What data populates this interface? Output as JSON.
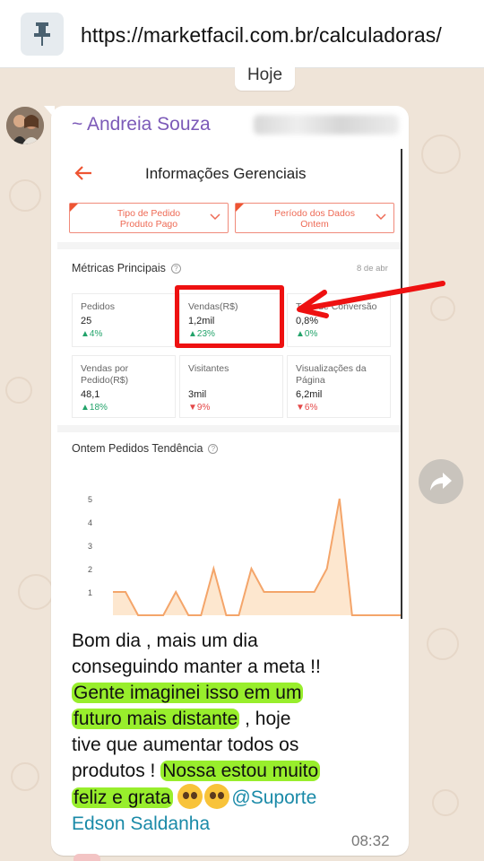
{
  "browser": {
    "url": "https://marketfacil.com.br/calculadoras/",
    "pin_icon": "pin-icon"
  },
  "chat": {
    "date_chip": "Hoje",
    "sender_name": "~ Andreia Souza",
    "time": "08:32",
    "message": {
      "line1": "Bom dia , mais um dia",
      "line2": "conseguindo manter a meta !!",
      "hl1a": "Gente imaginei isso em um",
      "hl1b": "futuro mais distante",
      "after_hl1": " , hoje",
      "line5": "tive que aumentar todos os",
      "line6_start": "produtos ! ",
      "hl2a": "Nossa estou muito",
      "hl2b": "feliz e grata",
      "mention_a": "@Suporte",
      "mention_b": "Edson Saldanha"
    }
  },
  "screenshot": {
    "title": "Informações Gerenciais",
    "filter1_line1": "Tipo de Pedido",
    "filter1_line2": "Produto Pago",
    "filter2_line1": "Período dos Dados",
    "filter2_line2": "Ontem",
    "metrics_title": "Métricas Principais",
    "metrics_date": "8 de abr",
    "cards": [
      {
        "label": "Pedidos",
        "value": "25",
        "change": "▲4%",
        "trend": "up"
      },
      {
        "label": "Vendas(R$)",
        "value": "1,2mil",
        "change": "▲23%",
        "trend": "up"
      },
      {
        "label": "Taxa de Conversão",
        "value": "0,8%",
        "change": "▲0%",
        "trend": "up"
      },
      {
        "label": "Vendas por Pedido(R$)",
        "value": "48,1",
        "change": "▲18%",
        "trend": "up"
      },
      {
        "label": "Visitantes",
        "value": "3mil",
        "change": "▼9%",
        "trend": "down"
      },
      {
        "label": "Visualizações da Página",
        "value": "6,2mil",
        "change": "▼6%",
        "trend": "down"
      }
    ],
    "trend_title": "Ontem Pedidos Tendência",
    "accent_color": "#ee5533"
  },
  "chart_data": {
    "type": "area",
    "title": "Ontem Pedidos Tendência",
    "y_ticks": [
      "5",
      "4",
      "3",
      "2",
      "1"
    ],
    "ylim": [
      0,
      5
    ],
    "x": [
      0,
      1,
      2,
      3,
      4,
      5,
      6,
      7,
      8,
      9,
      10,
      11,
      12,
      13,
      14,
      15,
      16,
      17,
      18,
      19,
      20,
      21,
      22,
      23
    ],
    "values": [
      1,
      1,
      0,
      0,
      0,
      1,
      0,
      0,
      2,
      0,
      0,
      2,
      1,
      1,
      1,
      1,
      1,
      2,
      5,
      0,
      0,
      0,
      0,
      0
    ],
    "color": "#f4a56a"
  }
}
